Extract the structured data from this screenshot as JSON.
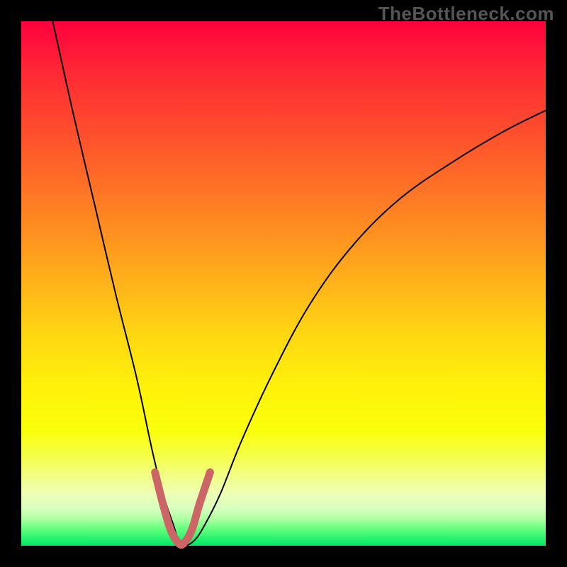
{
  "watermark": "TheBottleneck.com",
  "chart_data": {
    "type": "line",
    "title": "",
    "xlabel": "",
    "ylabel": "",
    "xlim": [
      0,
      100
    ],
    "ylim": [
      0,
      100
    ],
    "grid": false,
    "legend": false,
    "gradient_background": {
      "top": "#ff003e",
      "middle": "#ffe312",
      "bottom": "#00e765"
    },
    "series": [
      {
        "name": "bottleneck-curve",
        "color": "#000000",
        "width": 2,
        "x": [
          6,
          10,
          14,
          18,
          22,
          25,
          27,
          29,
          30,
          31,
          33,
          35,
          38,
          42,
          48,
          55,
          63,
          72,
          82,
          92,
          100
        ],
        "y": [
          100,
          82,
          65,
          48,
          32,
          18,
          10,
          4,
          1,
          0,
          1,
          4,
          10,
          20,
          33,
          46,
          57,
          66,
          73,
          79,
          83
        ]
      },
      {
        "name": "bottom-highlight",
        "color": "#cc6666",
        "width": 11,
        "linecap": "round",
        "x": [
          25.5,
          27,
          28.5,
          30,
          31,
          32.5,
          34,
          36
        ],
        "y": [
          14,
          8,
          3,
          0.5,
          0.5,
          3,
          8,
          14
        ]
      }
    ]
  }
}
